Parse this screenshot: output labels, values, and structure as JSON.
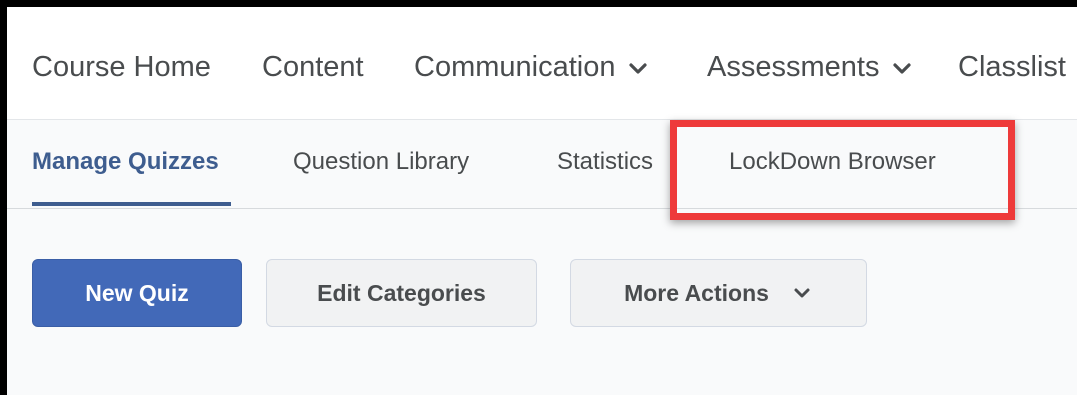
{
  "topnav": {
    "items": [
      {
        "label": "Course Home",
        "has_dropdown": false
      },
      {
        "label": "Content",
        "has_dropdown": false
      },
      {
        "label": "Communication",
        "has_dropdown": true
      },
      {
        "label": "Assessments",
        "has_dropdown": true
      },
      {
        "label": "Classlist",
        "has_dropdown": false
      }
    ]
  },
  "subtabs": {
    "items": [
      {
        "label": "Manage Quizzes",
        "active": true
      },
      {
        "label": "Question Library",
        "active": false
      },
      {
        "label": "Statistics",
        "active": false
      },
      {
        "label": "LockDown Browser",
        "active": false,
        "highlighted": true
      }
    ]
  },
  "actions": {
    "new_quiz": "New Quiz",
    "edit_categories": "Edit Categories",
    "more_actions": "More Actions"
  },
  "colors": {
    "accent": "#3e5d8f",
    "primary_button": "#4269b8",
    "highlight_box": "#ee3a3a",
    "text": "#494c4e"
  },
  "icons": {
    "dropdown": "chevron-down-icon"
  }
}
